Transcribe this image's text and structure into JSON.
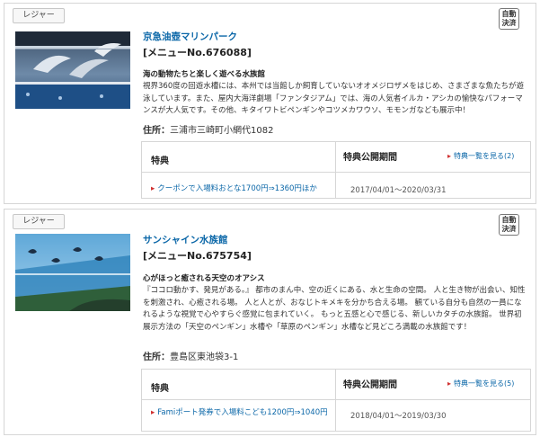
{
  "listings": [
    {
      "category": "レジャー",
      "badge": [
        "自動",
        "決済"
      ],
      "title": "京急油壺マリンパーク",
      "menu_no": "[メニューNo.676088]",
      "catchphrase": "海の動物たちと楽しく遊べる水族館",
      "description": "視界360度の回遊水槽には、本州では当館しか飼育していないオオメジロザメをはじめ、さまざまな魚たちが遊泳しています。また、屋内大海洋劇場「ファンタジアム」では、海の人気者イルカ・アシカの愉快なパフォーマンスが大人気です。その他、キタイワトビペンギンやコツメカワウソ、モモンガなども展示中！",
      "address_label": "住所：",
      "address": "三浦市三崎町小網代1082",
      "benefit_header": "特典",
      "period_header": "特典公開期間",
      "list_link": "特典一覧を見る(2)",
      "offer": "クーポンで入場料おとな1700円⇒1360円ほか",
      "period": "2017/04/01～2020/03/31"
    },
    {
      "category": "レジャー",
      "badge": [
        "自動",
        "決済"
      ],
      "title": "サンシャイン水族館",
      "menu_no": "[メニューNo.675754]",
      "catchphrase": "心がほっと癒される天空のオアシス",
      "description": "『ココロ動かす、発見がある。』 都市のまん中、空の近くにある、水と生命の空間。 人と生き物が出会い、知性を刺激され、心癒される場。 人と人とが、おなじトキメキを分かち合える場。 観ている自分も自然の一員になれるような視覚で心やすらぐ感覚に包まれていく。 もっと五感と心で感じる、新しいカタチの水族館。 世界初展示方法の「天空のペンギン」水槽や「草原のペンギン」水槽など見どころ満載の水族館です！",
      "address_label": "住所：",
      "address": "豊島区東池袋3-1",
      "benefit_header": "特典",
      "period_header": "特典公開期間",
      "list_link": "特典一覧を見る(5)",
      "offer": "Famiポート発券で入場料こども1200円⇒1040円",
      "period": "2018/04/01～2019/03/30"
    }
  ]
}
